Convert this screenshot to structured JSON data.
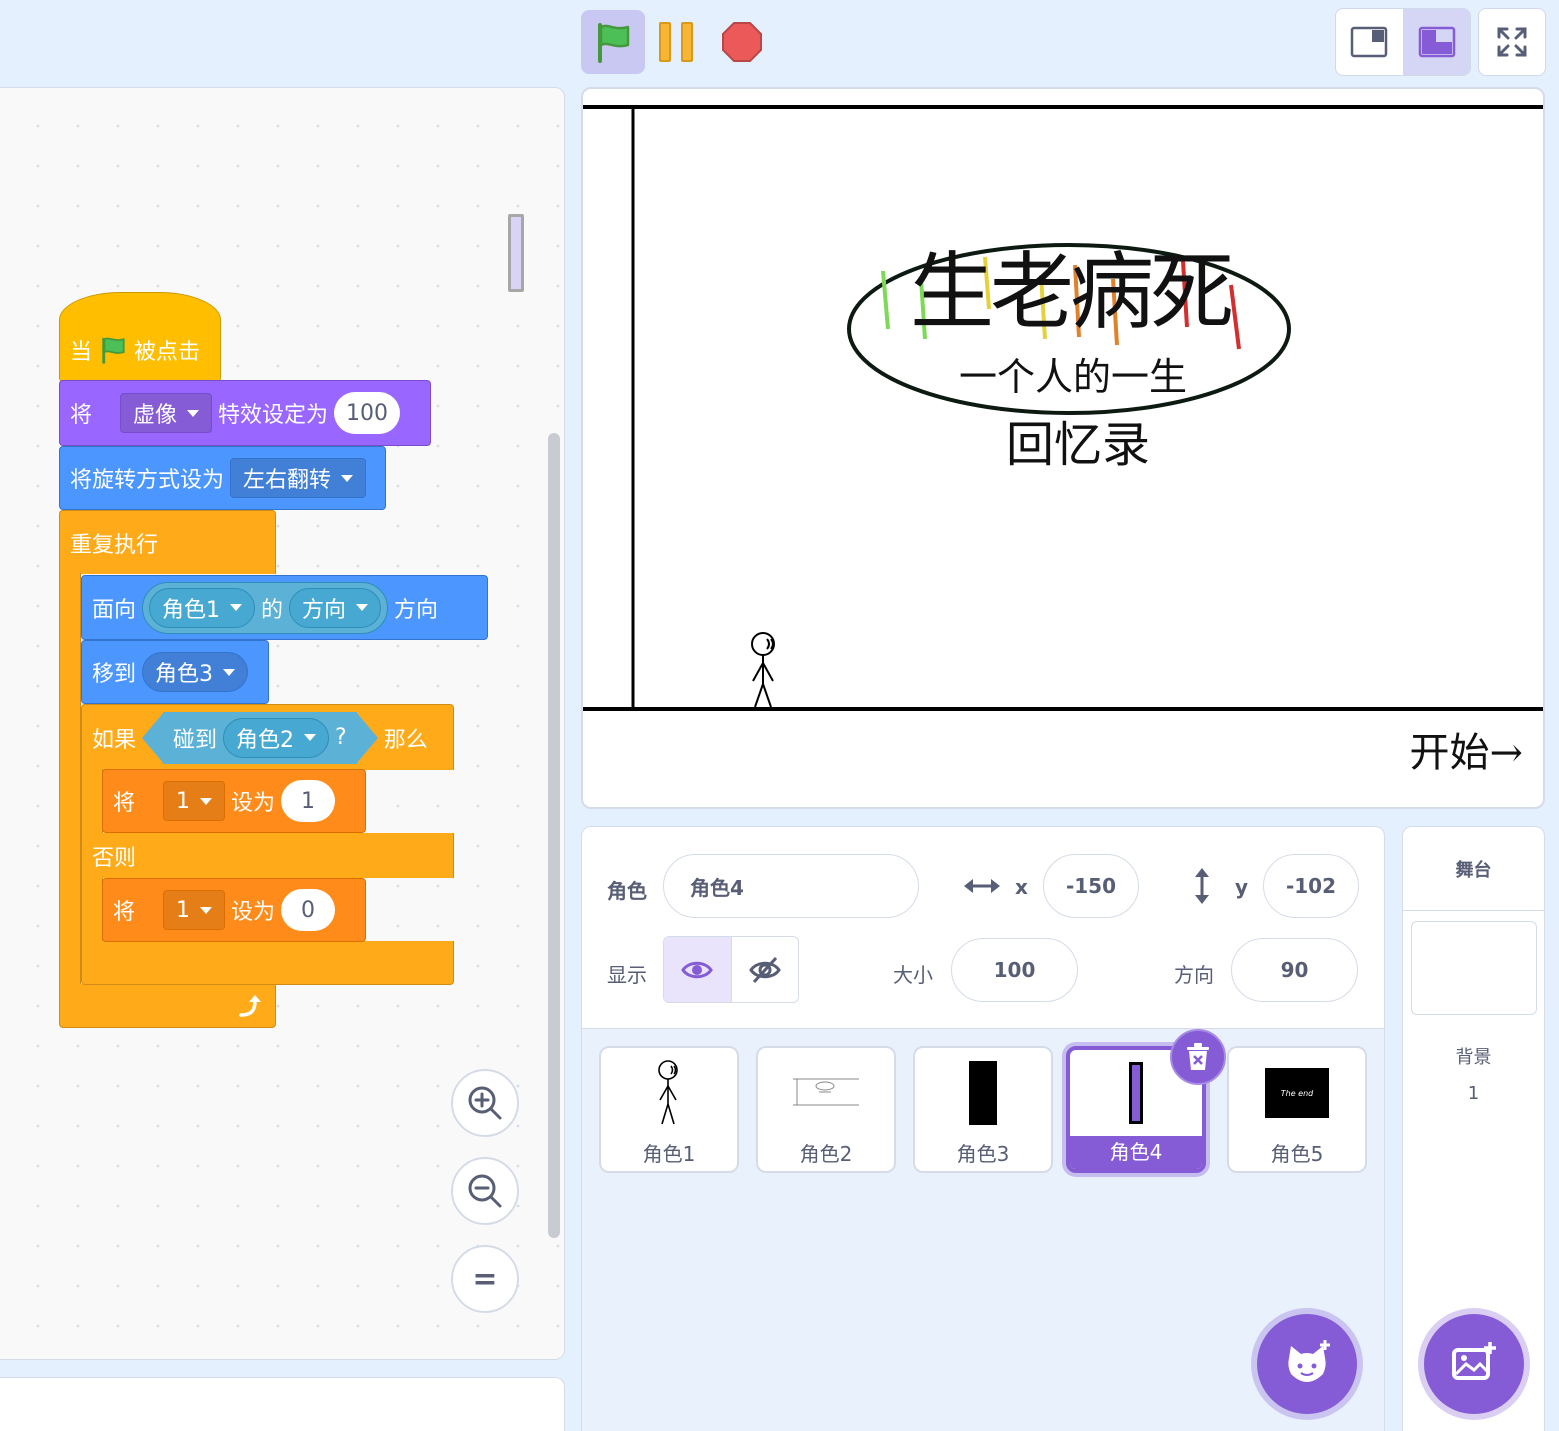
{
  "toolbar": {
    "green_flag": "green-flag-icon",
    "pause": "pause-icon",
    "stop": "stop-icon",
    "layout_small": "small-stage-icon",
    "layout_large": "large-stage-icon",
    "fullscreen": "fullscreen-icon"
  },
  "script": {
    "hat": {
      "when": "当",
      "clicked": "被点击"
    },
    "effect": {
      "set": "将",
      "effect_name": "虚像",
      "set_to": "特效设定为",
      "value": "100"
    },
    "rotation": {
      "label": "将旋转方式设为",
      "style": "左右翻转"
    },
    "forever": {
      "label": "重复执行"
    },
    "point": {
      "face": "面向",
      "sprite": "角色1",
      "of": "的",
      "attr": "方向",
      "direction": "方向"
    },
    "goto": {
      "label": "移到",
      "target": "角色3"
    },
    "if_else": {
      "if": "如果",
      "touching": "碰到",
      "target": "角色2",
      "q": "?",
      "then": "那么",
      "else": "否则"
    },
    "set1": {
      "set": "将",
      "var": "1",
      "to": "设为",
      "value": "1"
    },
    "set2": {
      "set": "将",
      "var": "1",
      "to": "设为",
      "value": "0"
    }
  },
  "zoom": {
    "in": "zoom-in-icon",
    "out": "zoom-out-icon",
    "reset": "="
  },
  "stage": {
    "title": "生老病死",
    "subtitle": "一个人的一生",
    "subtitle2": "回忆录",
    "start": "开始→"
  },
  "sprite_info": {
    "sprite_label": "角色",
    "sprite_name": "角色4",
    "x_label": "x",
    "x": "-150",
    "y_label": "y",
    "y": "-102",
    "show_label": "显示",
    "size_label": "大小",
    "size": "100",
    "direction_label": "方向",
    "direction": "90"
  },
  "sprites": [
    {
      "name": "角色1",
      "selected": false
    },
    {
      "name": "角色2",
      "selected": false
    },
    {
      "name": "角色3",
      "selected": false
    },
    {
      "name": "角色4",
      "selected": true
    },
    {
      "name": "角色5",
      "selected": false
    }
  ],
  "sprite5_thumb_text": "The end",
  "stage_panel": {
    "title": "舞台",
    "backdrops_label": "背景",
    "backdrops_count": "1"
  },
  "colors": {
    "accent": "#855cd6",
    "event": "#ffbf00",
    "looks": "#9966ff",
    "motion": "#4c97ff",
    "control": "#ffab19",
    "data": "#ff8c1a",
    "sensing": "#5cb1d6"
  }
}
